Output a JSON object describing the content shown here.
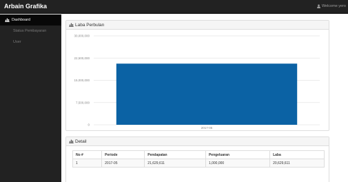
{
  "app": {
    "brand": "Arbain Grafika",
    "user_menu": "Welcome yero"
  },
  "sidebar": {
    "items": [
      {
        "label": "Dashboard",
        "icon": "bar-chart-icon",
        "active": true
      },
      {
        "label": "Status Pembayaran",
        "active": false
      },
      {
        "label": "User",
        "active": false
      }
    ]
  },
  "chart_panel": {
    "title": "Laba Perbulan"
  },
  "chart_data": {
    "type": "bar",
    "categories": [
      "2017-05"
    ],
    "values": [
      20629611
    ],
    "ylim": [
      0,
      30000000
    ],
    "yticks": [
      0,
      7500000,
      15000000,
      22500000,
      30000000
    ],
    "ytick_labels": [
      "0",
      "7,500,000",
      "15,000,000",
      "22,500,000",
      "30,000,000"
    ],
    "bar_color": "#0b62a4",
    "grid": true
  },
  "detail": {
    "title": "Detail",
    "columns": [
      "No #",
      "Periode",
      "Pendapatan",
      "Pengeluaran",
      "Laba"
    ],
    "rows": [
      [
        "1",
        "2017-05",
        "21,629,611",
        "1,000,000",
        "20,629,611"
      ]
    ]
  }
}
